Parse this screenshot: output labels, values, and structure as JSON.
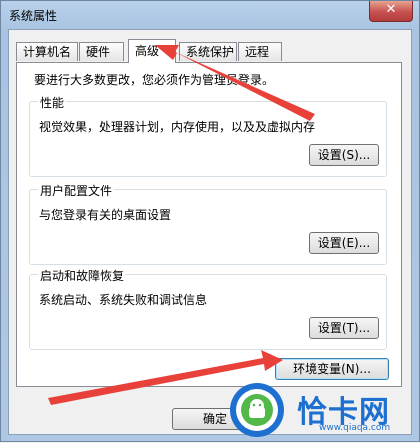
{
  "window": {
    "title": "系统属性",
    "close_glyph": "✕"
  },
  "tabs": [
    {
      "label": "计算机名"
    },
    {
      "label": "硬件"
    },
    {
      "label": "高级",
      "selected": true
    },
    {
      "label": "系统保护"
    },
    {
      "label": "远程"
    }
  ],
  "panel": {
    "notice": "要进行大多数更改，您必须作为管理员登录。",
    "groups": [
      {
        "title": "性能",
        "description": "视觉效果，处理器计划，内存使用，以及及虚拟内存",
        "button": "设置(S)..."
      },
      {
        "title": "用户配置文件",
        "description": "与您登录有关的桌面设置",
        "button": "设置(E)..."
      },
      {
        "title": "启动和故障恢复",
        "description": "系统启动、系统失败和调试信息",
        "button": "设置(T)..."
      }
    ],
    "env_button": "环境变量(N)..."
  },
  "footer": {
    "ok_button": "确定"
  },
  "watermark": {
    "text": "恰卡网",
    "url": "www.qiaqa.com"
  },
  "colors": {
    "annotation_arrow": "#e8413a",
    "accent_blue": "#1d6fd0"
  }
}
